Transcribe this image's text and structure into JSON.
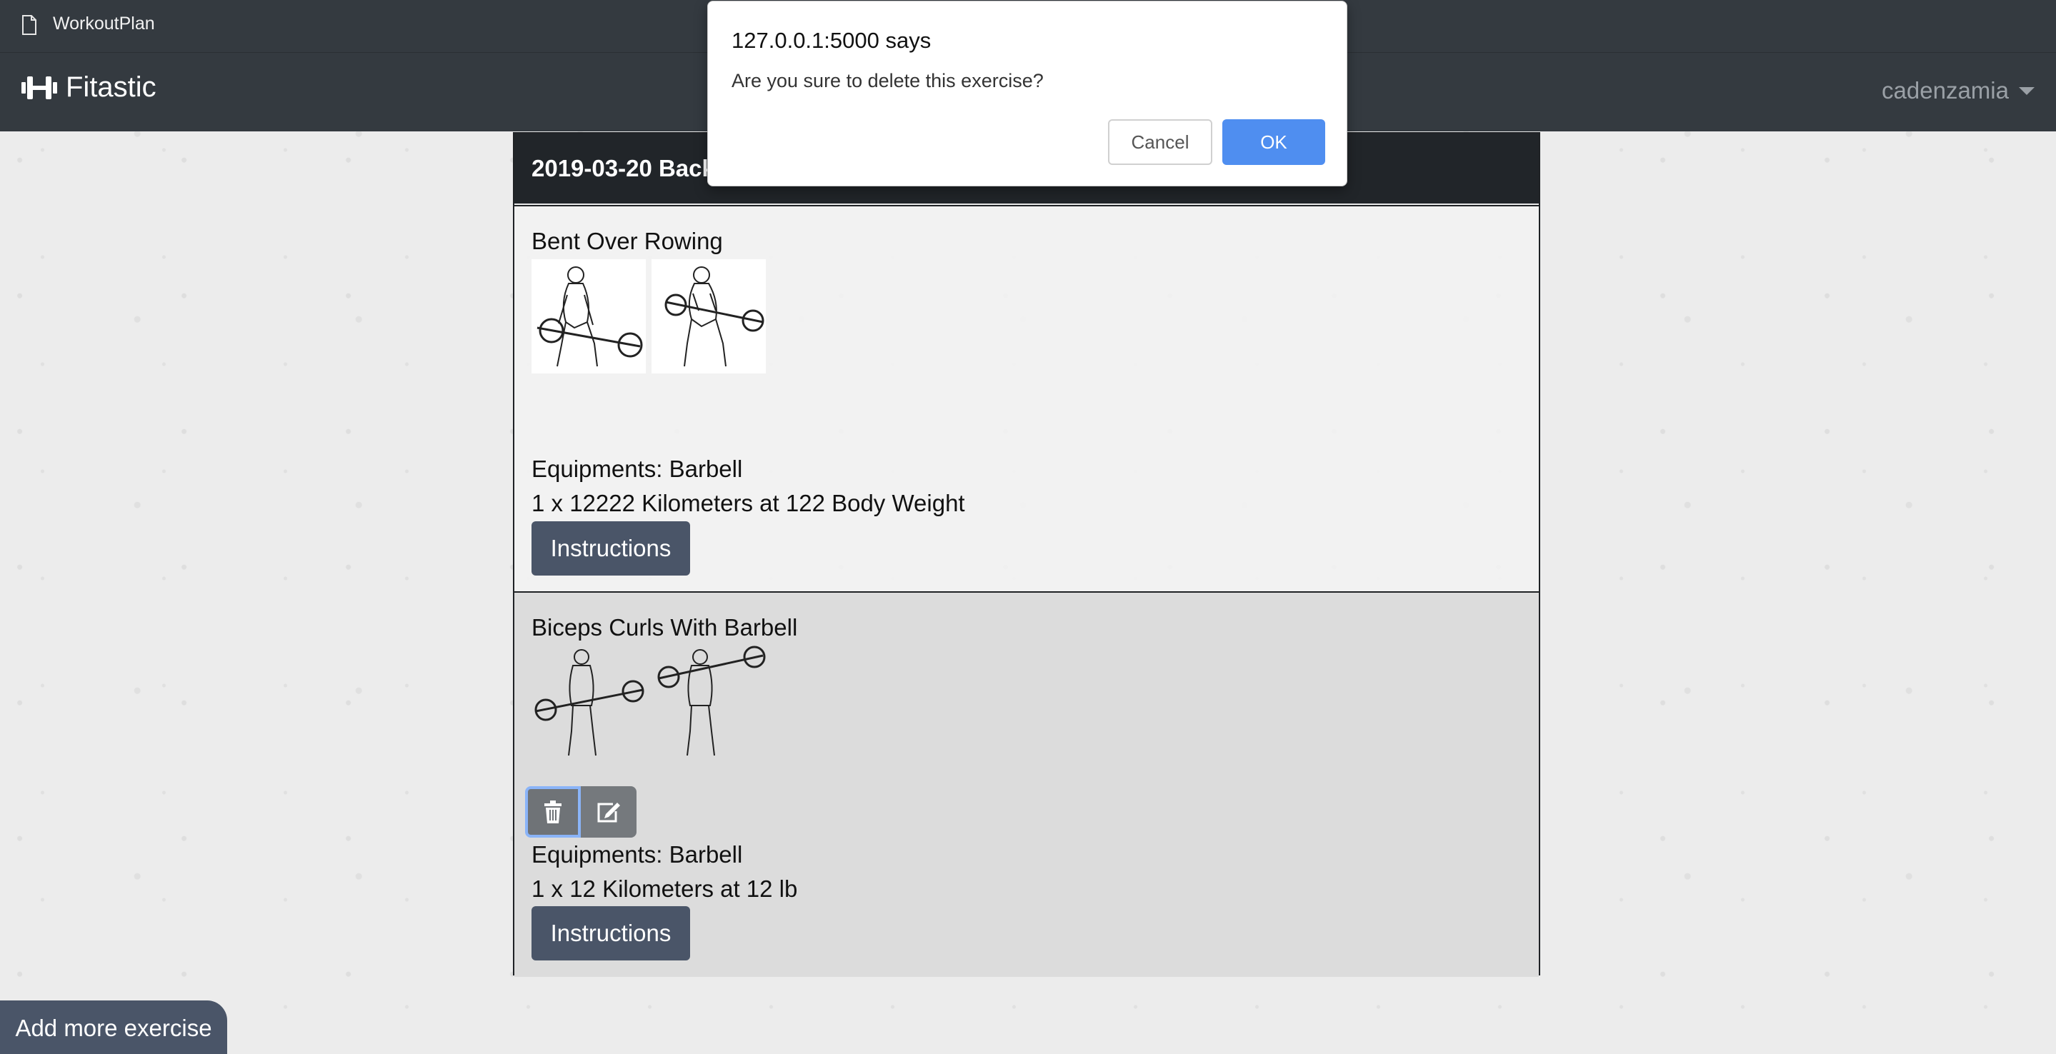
{
  "browser": {
    "tab_title": "WorkoutPlan",
    "tab_icon": "document-icon"
  },
  "navbar": {
    "brand_name": "Fitastic",
    "brand_icon": "dumbbell-icon",
    "username": "cadenzamia"
  },
  "plan": {
    "title": "2019-03-20 Back",
    "exercises": [
      {
        "name": "Bent Over Rowing",
        "equipment": "Equipments: Barbell",
        "sets": "1 x 12222 Kilometers at 122 Body Weight",
        "instructions_label": "Instructions"
      },
      {
        "name": "Biceps Curls With Barbell",
        "equipment": "Equipments: Barbell",
        "sets": "1 x 12 Kilometers at 12 lb",
        "instructions_label": "Instructions"
      }
    ]
  },
  "add_more_label": "Add more exercise",
  "dialog": {
    "origin": "127.0.0.1:5000 says",
    "message": "Are you sure to delete this exercise?",
    "cancel_label": "Cancel",
    "ok_label": "OK"
  },
  "colors": {
    "navbar": "#343a40",
    "button": "#4a5568",
    "ok_button": "#4f8ef0"
  }
}
